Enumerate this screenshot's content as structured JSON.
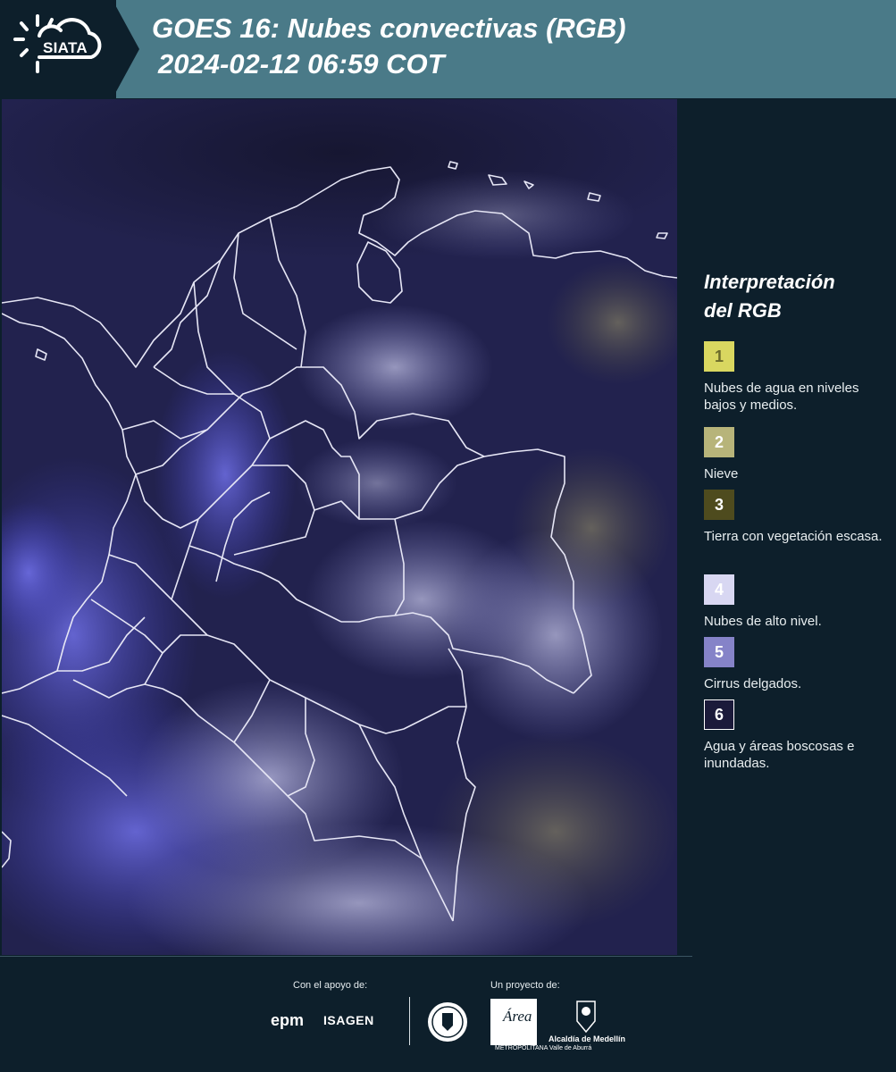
{
  "header": {
    "logo_text": "SIATA",
    "title_line1": "GOES 16: Nubes convectivas (RGB)",
    "title_line2": "2024-02-12 06:59 COT"
  },
  "legend": {
    "title_line1": "Interpretación",
    "title_line2": "del RGB",
    "items": [
      {
        "num": "1",
        "label": "Nubes de agua en niveles bajos y medios.",
        "color": "#d9d760",
        "text_color": "#6b6a2a"
      },
      {
        "num": "2",
        "label": "Nieve",
        "color": "#b7b47a",
        "text_color": "#ffffff"
      },
      {
        "num": "3",
        "label": "Tierra con vegetación escasa.",
        "color": "#4e4b1e",
        "text_color": "#ffffff"
      },
      {
        "num": "4",
        "label": "Nubes de alto nivel.",
        "color": "#d8d7f2",
        "text_color": "#ffffff"
      },
      {
        "num": "5",
        "label": "Cirrus delgados.",
        "color": "#8583c8",
        "text_color": "#ffffff"
      },
      {
        "num": "6",
        "label": "Agua y áreas boscosas e inundadas.",
        "color": "#1b1a3a",
        "text_color": "#ffffff"
      }
    ]
  },
  "footer": {
    "support_caption": "Con el apoyo de:",
    "project_caption": "Un proyecto de:",
    "epm": "epm",
    "isagen": "ISAGEN",
    "area_mark": "Área",
    "area_sub": "METROPOLITANA Valle de Aburrá",
    "medellin": "Alcaldía de Medellín"
  },
  "colors": {
    "header_bg": "#4a7a88",
    "page_bg": "#0d1f2b",
    "map_bg": "#21214d"
  }
}
